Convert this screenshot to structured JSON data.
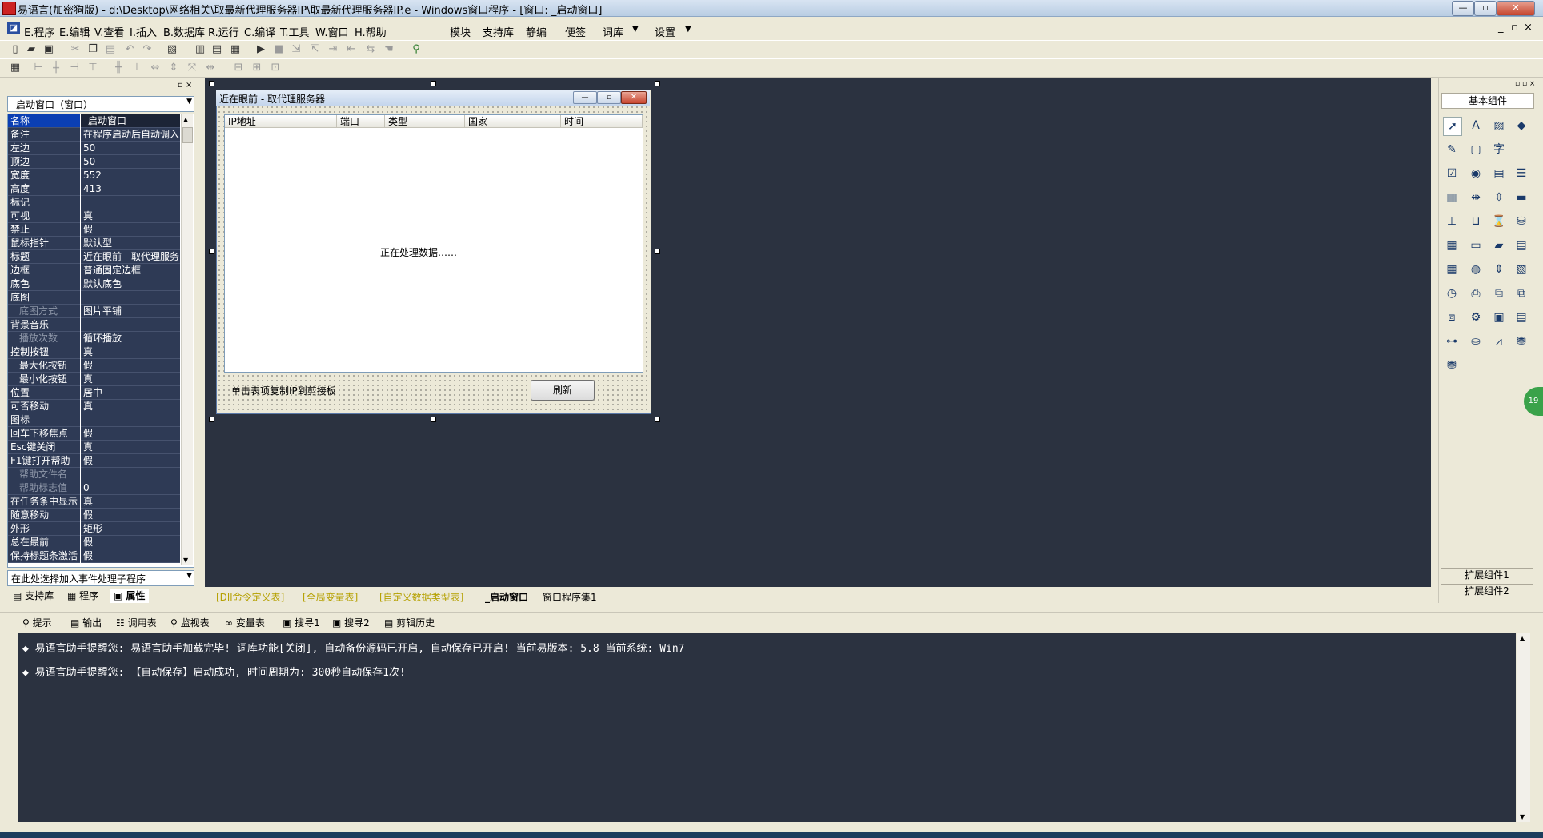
{
  "window": {
    "title": "易语言(加密狗版) - d:\\Desktop\\网络相关\\取最新代理服务器IP\\取最新代理服务器IP.e - Windows窗口程序 - [窗口: _启动窗口]",
    "min": "—",
    "restore": "▫",
    "close": "✕"
  },
  "menu": {
    "items": [
      "E.程序",
      "E.编辑",
      "V.查看",
      "I.插入",
      "B.数据库",
      "R.运行",
      "C.编译",
      "T.工具",
      "W.窗口",
      "H.帮助"
    ],
    "right_items": [
      "模块",
      "支持库",
      "静编",
      "便签",
      "词库",
      "设置"
    ],
    "mdi_buttons": [
      "_",
      "▫",
      "×"
    ]
  },
  "properties": {
    "combo": "_启动窗口（窗口）",
    "rows": [
      {
        "name": "名称",
        "value": "_启动窗口"
      },
      {
        "name": "备注",
        "value": "在程序启动后自动调入"
      },
      {
        "name": "左边",
        "value": "50"
      },
      {
        "name": "顶边",
        "value": "50"
      },
      {
        "name": "宽度",
        "value": "552"
      },
      {
        "name": "高度",
        "value": "413"
      },
      {
        "name": "标记",
        "value": ""
      },
      {
        "name": "可视",
        "value": "真"
      },
      {
        "name": "禁止",
        "value": "假"
      },
      {
        "name": "鼠标指针",
        "value": "默认型"
      },
      {
        "name": "标题",
        "value": "近在眼前 - 取代理服务"
      },
      {
        "name": "边框",
        "value": "普通固定边框"
      },
      {
        "name": "底色",
        "value": "默认底色"
      },
      {
        "name": "底图",
        "value": ""
      },
      {
        "name": "底图方式",
        "value": "图片平铺"
      },
      {
        "name": "背景音乐",
        "value": ""
      },
      {
        "name": "播放次数",
        "value": "循环播放"
      },
      {
        "name": "控制按钮",
        "value": "真"
      },
      {
        "name": "最大化按钮",
        "value": "假"
      },
      {
        "name": "最小化按钮",
        "value": "真"
      },
      {
        "name": "位置",
        "value": "居中"
      },
      {
        "name": "可否移动",
        "value": "真"
      },
      {
        "name": "图标",
        "value": ""
      },
      {
        "name": "回车下移焦点",
        "value": "假"
      },
      {
        "name": "Esc键关闭",
        "value": "真"
      },
      {
        "name": "F1键打开帮助",
        "value": "假"
      },
      {
        "name": "帮助文件名",
        "value": ""
      },
      {
        "name": "帮助标志值",
        "value": "0"
      },
      {
        "name": "在任务条中显示",
        "value": "真"
      },
      {
        "name": "随意移动",
        "value": "假"
      },
      {
        "name": "外形",
        "value": "矩形"
      },
      {
        "name": "总在最前",
        "value": "假"
      },
      {
        "name": "保持标题条激活",
        "value": "假"
      }
    ],
    "event_combo": "在此处选择加入事件处理子程序",
    "tabs": [
      "支持库",
      "程序",
      "属性"
    ]
  },
  "form": {
    "title": "近在眼前 - 取代理服务器",
    "columns": [
      "IP地址",
      "端口",
      "类型",
      "国家",
      "时间"
    ],
    "processing_text": "正在处理数据……",
    "hint_label": "单击表项复制IP到剪接板",
    "refresh_button": "刷新"
  },
  "design_tabs": [
    "[Dll命令定义表]",
    "[全局变量表]",
    "[自定义数据类型表]",
    "_启动窗口",
    "窗口程序集1"
  ],
  "components": {
    "header": "基本组件",
    "ext1": "扩展组件1",
    "ext2": "扩展组件2",
    "badge": "19"
  },
  "output_tabs": [
    "提示",
    "输出",
    "调用表",
    "监视表",
    "变量表",
    "搜寻1",
    "搜寻2",
    "剪辑历史"
  ],
  "output_lines": [
    "易语言助手提醒您:  易语言助手加载完毕! 词库功能[关闭], 自动备份源码已开启, 自动保存已开启!  当前易版本: 5.8  当前系统: Win7",
    "易语言助手提醒您: 【自动保存】启动成功, 时间周期为: 300秒自动保存1次!"
  ]
}
